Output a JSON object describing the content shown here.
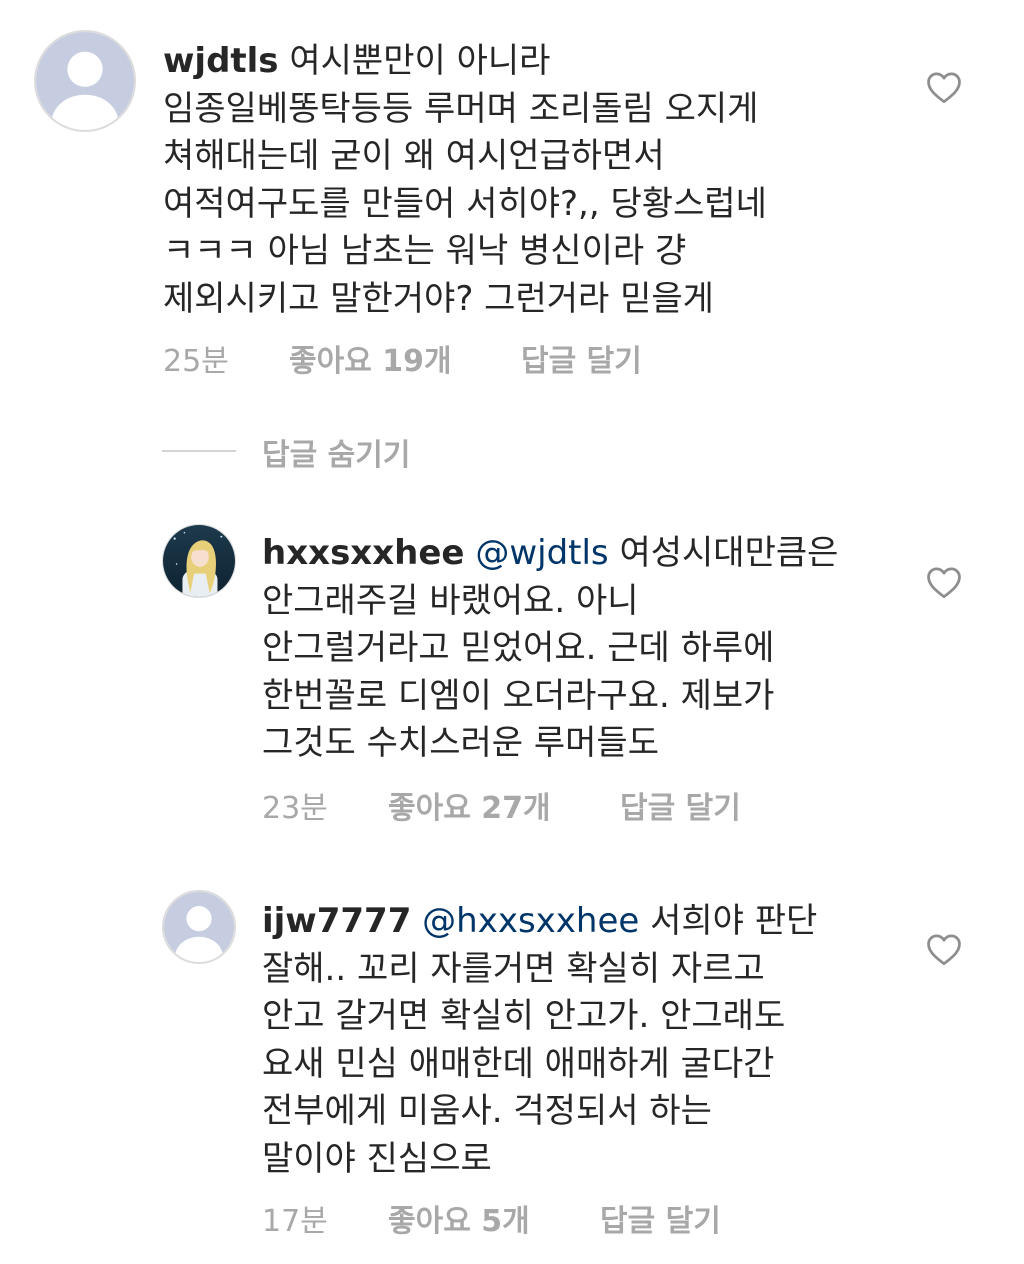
{
  "comments": [
    {
      "username": "wjdtls",
      "mention": "",
      "lines": [
        "여시뿐만이 아니라",
        "임종일베똥탁등등 루머며 조리돌림 오지게",
        "쳐해대는데 굳이 왜 여시언급하면서",
        "여적여구도를 만들어 서히야?,, 당황스럽네",
        "ㅋㅋㅋ 아님 남초는 워낙 병신이라 걍",
        "제외시키고 말한거야? 그런거라 믿을게"
      ],
      "time": "25분",
      "likes": "좋아요 19개",
      "reply": "답글 달기",
      "avatar": "default-avatar",
      "heart_icon": "heart-outline-icon"
    },
    {
      "username": "hxxsxxhee",
      "mention": "@wjdtls",
      "lines": [
        "여성시대만큼은",
        "안그래주길 바랬어요. 아니",
        "안그럴거라고 믿었어요. 근데 하루에",
        "한번꼴로 디엠이 오더라구요. 제보가",
        "그것도 수치스러운 루머들도"
      ],
      "time": "23분",
      "likes": "좋아요 27개",
      "reply": "답글 달기",
      "avatar": "anime-character-avatar",
      "heart_icon": "heart-outline-icon"
    },
    {
      "username": "ijw7777",
      "mention": "@hxxsxxhee",
      "lines": [
        "서희야 판단",
        "잘해.. 꼬리 자를거면 확실히 자르고",
        "안고 갈거면 확실히 안고가. 안그래도",
        "요새 민심 애매한데 애매하게 굴다간",
        "전부에게 미움사. 걱정되서 하는",
        "말이야 진심으로"
      ],
      "time": "17분",
      "likes": "좋아요 5개",
      "reply": "답글 달기",
      "avatar": "default-avatar",
      "heart_icon": "heart-outline-icon"
    }
  ],
  "hide_replies_label": "답글 숨기기",
  "colors": {
    "text": "#262626",
    "meta": "#a8a8a8",
    "mention": "#003569",
    "divider": "#d4d4d4",
    "avatar_bg": "#c7cde0"
  }
}
